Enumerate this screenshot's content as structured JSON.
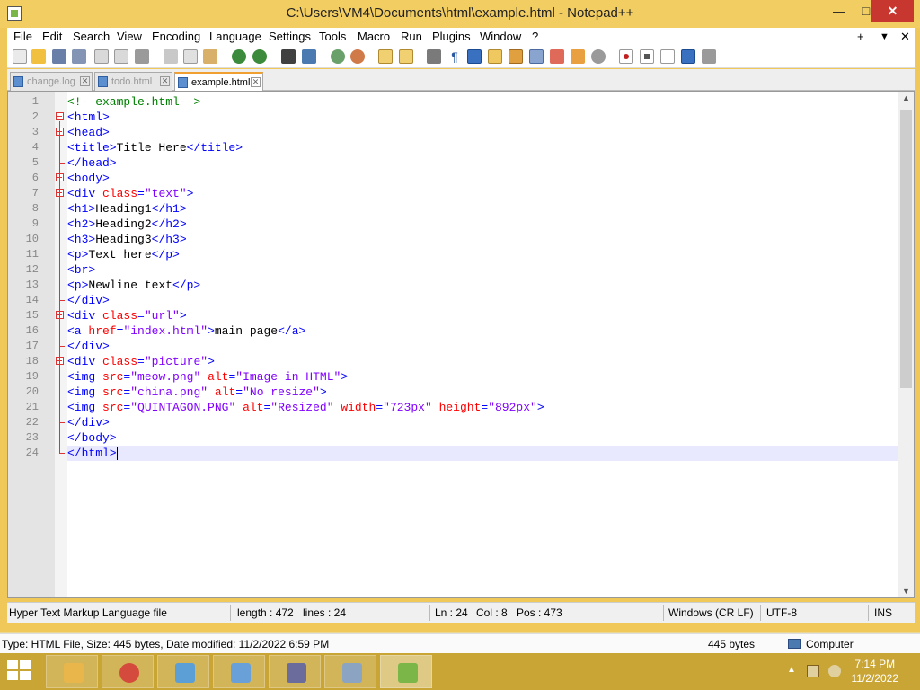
{
  "window": {
    "title": "C:\\Users\\VM4\\Documents\\html\\example.html - Notepad++"
  },
  "menu": [
    "File",
    "Edit",
    "Search",
    "View",
    "Encoding",
    "Language",
    "Settings",
    "Tools",
    "Macro",
    "Run",
    "Plugins",
    "Window",
    "?"
  ],
  "menu_right": {
    "plus": "+",
    "dropdown": "▼",
    "close": "✕"
  },
  "tabs": [
    {
      "label": "change.log",
      "active": false
    },
    {
      "label": "todo.html",
      "active": false
    },
    {
      "label": "example.html",
      "active": true
    }
  ],
  "editor": {
    "line_numbers": [
      "1",
      "2",
      "3",
      "4",
      "5",
      "6",
      "7",
      "8",
      "9",
      "10",
      "11",
      "12",
      "13",
      "14",
      "15",
      "16",
      "17",
      "18",
      "19",
      "20",
      "21",
      "22",
      "23",
      "24"
    ],
    "current_line": 24,
    "colors": {
      "tag": "#0000ff",
      "attr": "#ff0000",
      "string": "#8000ff",
      "comment": "#008000",
      "text": "#000000"
    },
    "lines": [
      [
        {
          "t": "<!--example.html-->",
          "c": "comment"
        }
      ],
      [
        {
          "t": "<html>",
          "c": "tag"
        }
      ],
      [
        {
          "t": "<head>",
          "c": "tag"
        }
      ],
      [
        {
          "t": "<title>",
          "c": "tag"
        },
        {
          "t": "Title Here",
          "c": "text"
        },
        {
          "t": "</title>",
          "c": "tag"
        }
      ],
      [
        {
          "t": "</head>",
          "c": "tag"
        }
      ],
      [
        {
          "t": "<body>",
          "c": "tag"
        }
      ],
      [
        {
          "t": "<div ",
          "c": "tag"
        },
        {
          "t": "class",
          "c": "attr"
        },
        {
          "t": "=",
          "c": "tag"
        },
        {
          "t": "\"text\"",
          "c": "string"
        },
        {
          "t": ">",
          "c": "tag"
        }
      ],
      [
        {
          "t": "<h1>",
          "c": "tag"
        },
        {
          "t": "Heading1",
          "c": "text"
        },
        {
          "t": "</h1>",
          "c": "tag"
        }
      ],
      [
        {
          "t": "<h2>",
          "c": "tag"
        },
        {
          "t": "Heading2",
          "c": "text"
        },
        {
          "t": "</h2>",
          "c": "tag"
        }
      ],
      [
        {
          "t": "<h3>",
          "c": "tag"
        },
        {
          "t": "Heading3",
          "c": "text"
        },
        {
          "t": "</h3>",
          "c": "tag"
        }
      ],
      [
        {
          "t": "<p>",
          "c": "tag"
        },
        {
          "t": "Text here",
          "c": "text"
        },
        {
          "t": "</p>",
          "c": "tag"
        }
      ],
      [
        {
          "t": "<br>",
          "c": "tag"
        }
      ],
      [
        {
          "t": "<p>",
          "c": "tag"
        },
        {
          "t": "Newline text",
          "c": "text"
        },
        {
          "t": "</p>",
          "c": "tag"
        }
      ],
      [
        {
          "t": "</div>",
          "c": "tag"
        }
      ],
      [
        {
          "t": "<div ",
          "c": "tag"
        },
        {
          "t": "class",
          "c": "attr"
        },
        {
          "t": "=",
          "c": "tag"
        },
        {
          "t": "\"url\"",
          "c": "string"
        },
        {
          "t": ">",
          "c": "tag"
        }
      ],
      [
        {
          "t": "<a ",
          "c": "tag"
        },
        {
          "t": "href",
          "c": "attr"
        },
        {
          "t": "=",
          "c": "tag"
        },
        {
          "t": "\"index.html\"",
          "c": "string"
        },
        {
          "t": ">",
          "c": "tag"
        },
        {
          "t": "main page",
          "c": "text"
        },
        {
          "t": "</a>",
          "c": "tag"
        }
      ],
      [
        {
          "t": "</div>",
          "c": "tag"
        }
      ],
      [
        {
          "t": "<div ",
          "c": "tag"
        },
        {
          "t": "class",
          "c": "attr"
        },
        {
          "t": "=",
          "c": "tag"
        },
        {
          "t": "\"picture\"",
          "c": "string"
        },
        {
          "t": ">",
          "c": "tag"
        }
      ],
      [
        {
          "t": "<img ",
          "c": "tag"
        },
        {
          "t": "src",
          "c": "attr"
        },
        {
          "t": "=",
          "c": "tag"
        },
        {
          "t": "\"meow.png\"",
          "c": "string"
        },
        {
          "t": " ",
          "c": "tag"
        },
        {
          "t": "alt",
          "c": "attr"
        },
        {
          "t": "=",
          "c": "tag"
        },
        {
          "t": "\"Image in HTML\"",
          "c": "string"
        },
        {
          "t": ">",
          "c": "tag"
        }
      ],
      [
        {
          "t": "<img ",
          "c": "tag"
        },
        {
          "t": "src",
          "c": "attr"
        },
        {
          "t": "=",
          "c": "tag"
        },
        {
          "t": "\"china.png\"",
          "c": "string"
        },
        {
          "t": " ",
          "c": "tag"
        },
        {
          "t": "alt",
          "c": "attr"
        },
        {
          "t": "=",
          "c": "tag"
        },
        {
          "t": "\"No resize\"",
          "c": "string"
        },
        {
          "t": ">",
          "c": "tag"
        }
      ],
      [
        {
          "t": "<img ",
          "c": "tag"
        },
        {
          "t": "src",
          "c": "attr"
        },
        {
          "t": "=",
          "c": "tag"
        },
        {
          "t": "\"QUINTAGON.PNG\"",
          "c": "string"
        },
        {
          "t": " ",
          "c": "tag"
        },
        {
          "t": "alt",
          "c": "attr"
        },
        {
          "t": "=",
          "c": "tag"
        },
        {
          "t": "\"Resized\"",
          "c": "string"
        },
        {
          "t": " ",
          "c": "tag"
        },
        {
          "t": "width",
          "c": "attr"
        },
        {
          "t": "=",
          "c": "tag"
        },
        {
          "t": "\"723px\"",
          "c": "string"
        },
        {
          "t": " ",
          "c": "tag"
        },
        {
          "t": "height",
          "c": "attr"
        },
        {
          "t": "=",
          "c": "tag"
        },
        {
          "t": "\"892px\"",
          "c": "string"
        },
        {
          "t": ">",
          "c": "tag"
        }
      ],
      [
        {
          "t": "</div>",
          "c": "tag"
        }
      ],
      [
        {
          "t": "</body>",
          "c": "tag"
        }
      ],
      [
        {
          "t": "</html>",
          "c": "tag"
        }
      ]
    ]
  },
  "status": {
    "file_type": "Hyper Text Markup Language file",
    "length": "length : 472",
    "lines": "lines : 24",
    "ln": "Ln : 24",
    "col": "Col : 8",
    "pos": "Pos : 473",
    "eol": "Windows (CR LF)",
    "encoding": "UTF-8",
    "mode": "INS"
  },
  "explorer": {
    "details": "Type: HTML File, Size: 445 bytes, Date modified: 11/2/2022 6:59 PM",
    "size": "445 bytes",
    "location": "Computer"
  },
  "taskbar": {
    "apps": [
      {
        "icon": "file-explorer-icon",
        "color": "#e8b64a",
        "active": false
      },
      {
        "icon": "chrome-icon",
        "color": "#d44a3c",
        "active": false
      },
      {
        "icon": "notebook-icon",
        "color": "#5c9ed6",
        "active": false
      },
      {
        "icon": "paint-icon",
        "color": "#6aa0d8",
        "active": false
      },
      {
        "icon": "task-scheduler-icon",
        "color": "#6c6c9c",
        "active": false
      },
      {
        "icon": "remote-desktop-icon",
        "color": "#8aa4c2",
        "active": false
      },
      {
        "icon": "notepadpp-icon",
        "color": "#7ab648",
        "active": true
      }
    ],
    "time": "7:14 PM",
    "date": "11/2/2022"
  }
}
